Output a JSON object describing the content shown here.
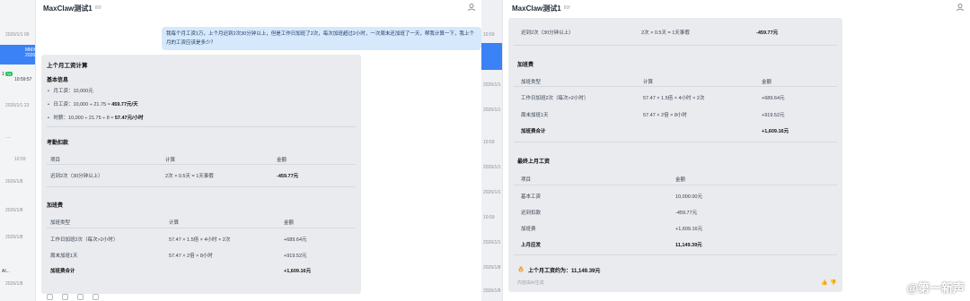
{
  "left_window": {
    "sidebar": {
      "items": [
        {
          "top": "2026/1/1 06"
        },
        {
          "name": "MMX",
          "tag": "",
          "sub": "2026/1/1 06",
          "active": true
        },
        {
          "name": "1",
          "tag": "Vt",
          "sub": "10:59:57"
        },
        {
          "name": "...",
          "sub": "2026/1/1 23"
        },
        {
          "name": "...",
          "sub": "2026/1/1 09"
        },
        {
          "name": "...",
          "sub": "...."
        },
        {
          "name": "...",
          "sub": "10:59"
        },
        {
          "name": "...",
          "sub": "2026/1/8"
        },
        {
          "name": "...",
          "sub": "2026/1/8"
        },
        {
          "name": "...",
          "sub": "2026/1/8"
        },
        {
          "name": "AI...",
          "sub": "2026/1/8"
        }
      ]
    },
    "title": "MaxClaw测试1",
    "title_sub": "80f",
    "question": "我每个月工资1万，上个月迟到2次30分钟以上，但是工作日加班了2次，每次加班超过2小时，一次周末还加班了一天，帮我计算一下，我上个月的工资应该是多少？",
    "section1": {
      "title": "上个月工资计算",
      "basic_title": "基本信息",
      "bullets": [
        {
          "pre": "月工资：10,000元",
          "bold": ""
        },
        {
          "pre": "日工资：10,000 ÷ 21.75 ≈ ",
          "bold": "459.77元/天"
        },
        {
          "pre": "时薪：10,000 ÷ 21.75 ÷ 8 ≈ ",
          "bold": "57.47元/小时"
        }
      ]
    },
    "attendance": {
      "title": "考勤扣款",
      "headers": [
        "项目",
        "计算",
        "金额"
      ],
      "row": [
        "迟到2次（30分钟以上）",
        "2次 × 0.5天 = 1天事假",
        "-459.77元"
      ]
    },
    "overtime": {
      "title": "加班费",
      "headers": [
        "加班类型",
        "计算",
        "金额"
      ],
      "rows": [
        [
          "工作日加班2次（每次>2小时）",
          "57.47 × 1.5倍 × 4小时 × 2次",
          "+689.64元"
        ],
        [
          "周末加班1天",
          "57.47 × 2倍 × 8小时",
          "+919.52元"
        ],
        [
          "加班费合计",
          "",
          "+1,609.16元"
        ]
      ]
    }
  },
  "right_window": {
    "title": "MaxClaw测试1",
    "title_sub": "80f",
    "top_row": [
      "迟到2次（30分钟以上）",
      "2次 × 0.5天 = 1天事假",
      "-459.77元"
    ],
    "overtime": {
      "title": "加班费",
      "headers": [
        "加班类型",
        "计算",
        "金额"
      ],
      "rows": [
        [
          "工作日加班2次（每次>2小时）",
          "57.47 × 1.5倍 × 4小时 × 2次",
          "+689.64元"
        ],
        [
          "周末加班1天",
          "57.47 × 2倍 × 8小时",
          "+919.52元"
        ],
        [
          "加班费合计",
          "",
          "+1,609.16元"
        ]
      ]
    },
    "final": {
      "title": "最终上月工资",
      "headers": [
        "项目",
        "金额"
      ],
      "rows": [
        [
          "基本工资",
          "10,000.00元"
        ],
        [
          "迟到扣款",
          "-459.77元"
        ],
        [
          "加班费",
          "+1,609.16元"
        ],
        [
          "上月应发",
          "11,149.39元"
        ]
      ]
    },
    "result_icon": "money-bag-icon",
    "result_text": "上个月工资约为：11,149.39元",
    "footer_text": "内容由AI生成"
  },
  "right_sidebar_sub": [
    "10:59",
    "2026/1/1 06",
    "2026/1/1 09",
    "10:59",
    "2026/1/1",
    "2026/1/1",
    "10:59",
    "2026/1/1",
    "2026/1/8",
    "2026/1/8"
  ],
  "watermark": "@第一新声",
  "colors": {
    "accent": "#3b82f6",
    "card": "#e9ebee",
    "bubble": "#d6e8fb"
  }
}
